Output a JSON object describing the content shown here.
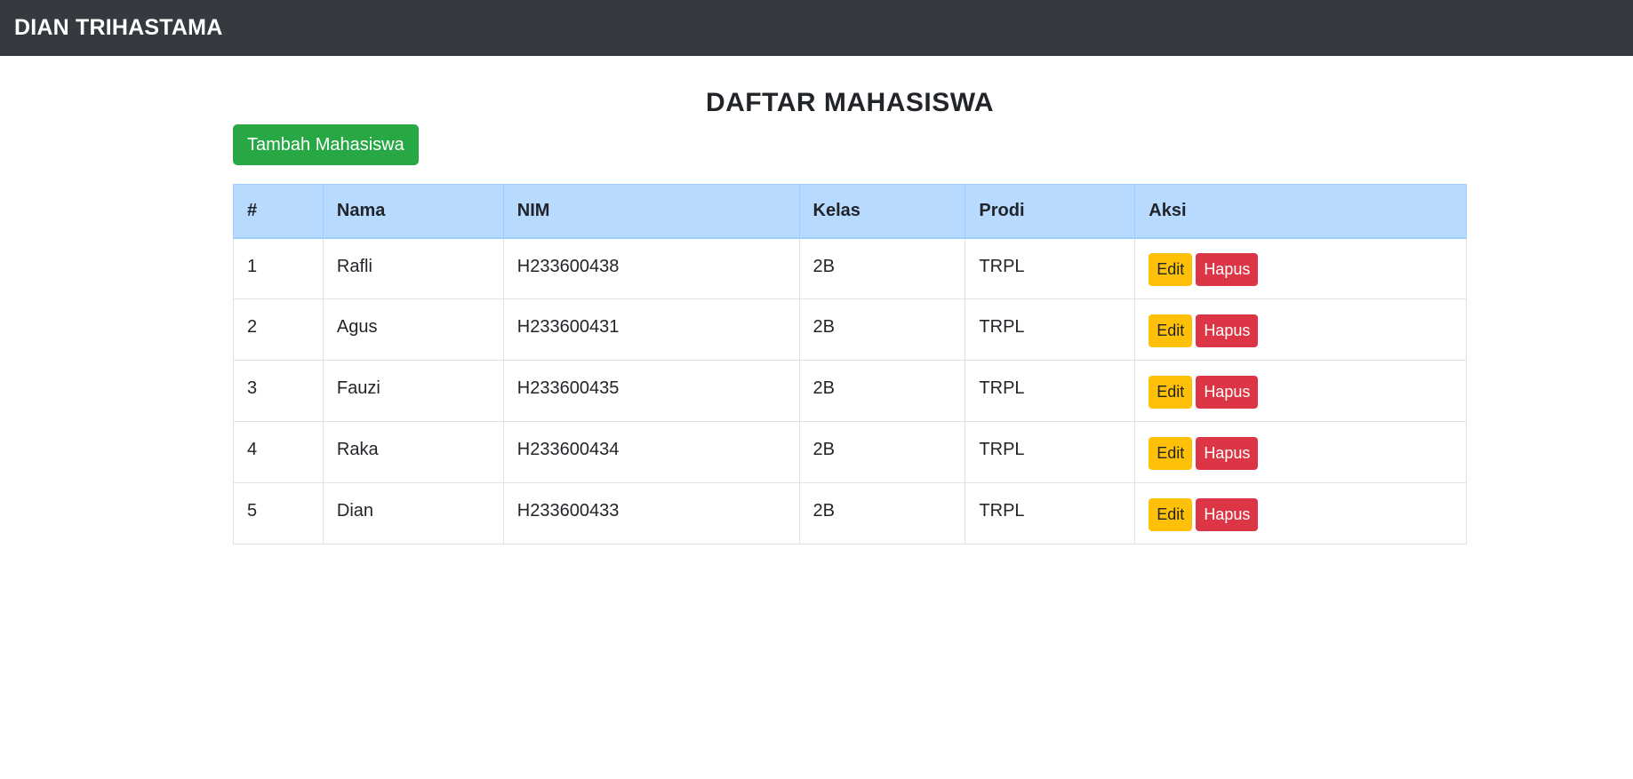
{
  "navbar": {
    "brand": "DIAN TRIHASTAMA"
  },
  "main": {
    "title": "DAFTAR MAHASISWA",
    "add_button_label": "Tambah Mahasiswa"
  },
  "table": {
    "headers": [
      "#",
      "Nama",
      "NIM",
      "Kelas",
      "Prodi",
      "Aksi"
    ],
    "rows": [
      {
        "no": "1",
        "nama": "Rafli",
        "nim": "H233600438",
        "kelas": "2B",
        "prodi": "TRPL"
      },
      {
        "no": "2",
        "nama": "Agus",
        "nim": "H233600431",
        "kelas": "2B",
        "prodi": "TRPL"
      },
      {
        "no": "3",
        "nama": "Fauzi",
        "nim": "H233600435",
        "kelas": "2B",
        "prodi": "TRPL"
      },
      {
        "no": "4",
        "nama": "Raka",
        "nim": "H233600434",
        "kelas": "2B",
        "prodi": "TRPL"
      },
      {
        "no": "5",
        "nama": "Dian",
        "nim": "H233600433",
        "kelas": "2B",
        "prodi": "TRPL"
      }
    ],
    "edit_label": "Edit",
    "delete_label": "Hapus"
  },
  "colors": {
    "navbar_bg": "#343a40",
    "success": "#28a745",
    "warning": "#ffc107",
    "danger": "#dc3545",
    "table_header_bg": "#b8daff"
  }
}
